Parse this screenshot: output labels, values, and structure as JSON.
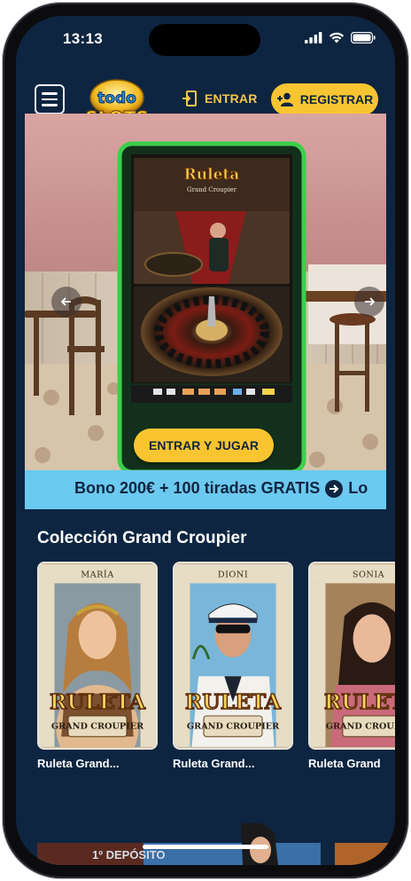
{
  "status_bar": {
    "time": "13:13",
    "icons": [
      "signal-icon",
      "wifi-icon",
      "battery-icon"
    ]
  },
  "header": {
    "logo_text_top": "todo",
    "logo_text_bottom": "SLOTS",
    "login_label": "ENTRAR",
    "register_label": "REGISTRAR"
  },
  "hero": {
    "machine_title": "Ruleta",
    "machine_subtitle": "Grand Croupier",
    "cta_label": "ENTRAR Y JUGAR"
  },
  "promo": {
    "text": "Bono 200€ + 100 tiradas GRATIS",
    "tail": "Lo"
  },
  "collection": {
    "title": "Colección Grand Croupier",
    "cards": [
      {
        "croupier": "MARÍA",
        "logo_word": "RULETA",
        "logo_sub": "GRAND CROUPIER",
        "name": "Ruleta Grand..."
      },
      {
        "croupier": "DIONI",
        "logo_word": "RULETA",
        "logo_sub": "GRAND CROUPIER",
        "name": "Ruleta Grand..."
      },
      {
        "croupier": "SONIA",
        "logo_word": "RULETA",
        "logo_sub": "GRAND CROUPIER",
        "name": "Ruleta Grand"
      }
    ]
  },
  "bottom_banner": {
    "text": "1º DEPÓSITO"
  },
  "colors": {
    "background": "#0d2540",
    "accent_yellow": "#f7c531",
    "ribbon_blue": "#6cc9ef"
  }
}
